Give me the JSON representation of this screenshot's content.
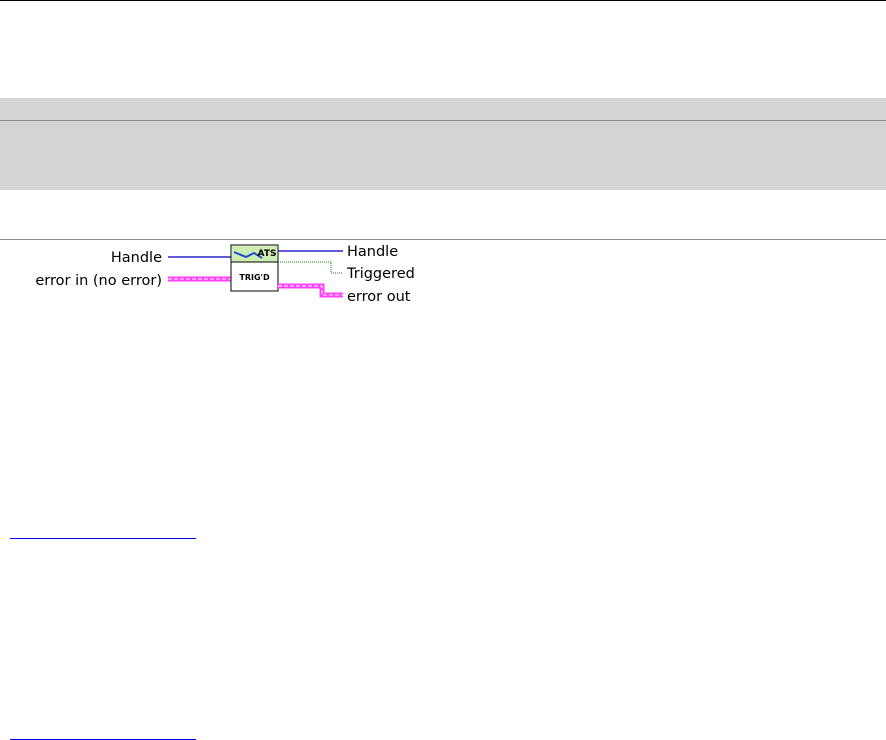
{
  "connector_pane": {
    "inputs": {
      "handle_label": "Handle",
      "error_in_label": "error in (no error)"
    },
    "outputs": {
      "handle_label": "Handle",
      "triggered_label": "Triggered",
      "error_out_label": "error out"
    },
    "icon": {
      "top_text": "ATS",
      "bottom_text": "TRIG'D"
    },
    "colors": {
      "reference_wire": "#2626c8",
      "error_wire": "#ff40ff",
      "boolean_wire": "#1a7f1a",
      "icon_header": "#cdeeb0",
      "gray_band": "#d4d4d4"
    }
  },
  "links": {
    "link1_text": "",
    "link2_text": ""
  }
}
